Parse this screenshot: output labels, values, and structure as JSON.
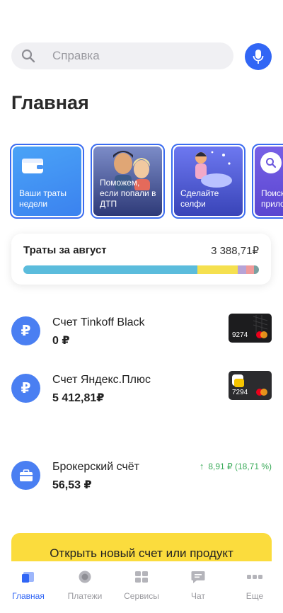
{
  "search": {
    "placeholder": "Справка"
  },
  "header": {
    "title": "Главная"
  },
  "stories": [
    {
      "label": "Ваши траты недели"
    },
    {
      "label": "Поможем, если попали в ДТП"
    },
    {
      "label": "Сделайте селфи"
    },
    {
      "label": "Поиск прило"
    }
  ],
  "spending": {
    "title": "Траты за август",
    "amount": "3 388,71₽",
    "segments": [
      {
        "fraction": 0.74,
        "color": "#5bbcdc"
      },
      {
        "fraction": 0.17,
        "color": "#f5e04f"
      },
      {
        "fraction": 0.035,
        "color": "#b7a3d6"
      },
      {
        "fraction": 0.035,
        "color": "#ef9a9a"
      },
      {
        "fraction": 0.02,
        "color": "#7aa0a0"
      }
    ]
  },
  "accounts": [
    {
      "name": "Счет Tinkoff Black",
      "balance": "0 ₽",
      "card_number": "9274",
      "icon": "ruble-icon"
    },
    {
      "name": "Счет Яндекс.Плюс",
      "balance": "5 412,81₽",
      "card_number": "7294",
      "icon": "ruble-icon"
    },
    {
      "name": "Брокерский счёт",
      "balance": "56,53 ₽",
      "delta": "8,91 ₽ (18,71 %)",
      "icon": "briefcase-icon"
    }
  ],
  "cta": {
    "label": "Открыть новый счет или продукт"
  },
  "tabbar": {
    "items": [
      {
        "label": "Главная",
        "icon": "home-icon",
        "active": true
      },
      {
        "label": "Платежи",
        "icon": "payments-icon"
      },
      {
        "label": "Сервисы",
        "icon": "services-icon"
      },
      {
        "label": "Чат",
        "icon": "chat-icon"
      },
      {
        "label": "Еще",
        "icon": "more-icon"
      }
    ]
  },
  "colors": {
    "accent": "#3166f5",
    "cta": "#fbdc3d",
    "positive": "#3bab5a"
  }
}
